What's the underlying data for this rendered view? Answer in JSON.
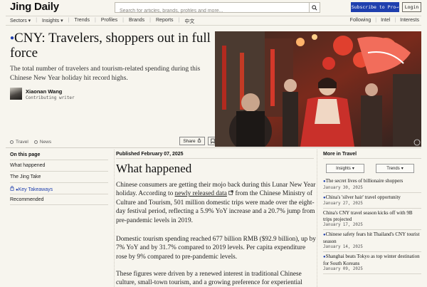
{
  "brand": {
    "logo": "Jing Daily",
    "accent": "#1f3fae"
  },
  "header": {
    "search_placeholder": "Search for articles, brands, profiles and more...",
    "subscribe_label": "Subscribe to Pro",
    "login_label": "Login"
  },
  "nav": {
    "left": [
      "Sectors",
      "Insights",
      "Trends",
      "Profiles",
      "Brands",
      "Reports",
      "中文"
    ],
    "right": [
      "Following",
      "Intel",
      "Interests"
    ]
  },
  "article": {
    "headline": "CNY: Travelers, shoppers out in full force",
    "dek": "The total number of travelers and tourism-related spending during this Chinese New Year holiday hit record highs.",
    "author_name": "Xiaonan Wang",
    "author_role": "Contributing writer",
    "tags": [
      "Travel",
      "News"
    ],
    "share_label": "Share",
    "published": "Published February 07, 2025",
    "section_heading": "What happened",
    "p1_a": "Chinese consumers are getting their mojo back during this Lunar New Year holiday. According to ",
    "p1_link": "newly released data",
    "p1_b": " from the Chinese Ministry of Culture and Tourism, 501 million domestic trips were made over the eight-day festival period, reflecting a 5.9% YoY increase and a 20.7% jump from pre-pandemic levels in 2019.",
    "p2": "Domestic tourism spending reached 677 billion RMB ($92.9 billion), up by 7% YoY and by 31.7% compared to 2019 levels. Per capita expenditure rose by 9% compared to pre-pandemic levels.",
    "p3": "These figures were driven by a renewed interest in traditional Chinese culture, small-town tourism, and a growing preference for experiential"
  },
  "toc": {
    "title": "On this page",
    "items": [
      {
        "label": "What happened"
      },
      {
        "label": "The Jing Take"
      },
      {
        "label": "Key Takeaways"
      },
      {
        "label": "Recommended"
      }
    ]
  },
  "rail": {
    "title": "More in Travel",
    "filters": [
      "Insights",
      "Trends"
    ],
    "items": [
      {
        "title": "The secret lives of billionaire shoppers",
        "date": "January 30, 2025"
      },
      {
        "title": "China's 'silver hair' travel opportunity",
        "date": "January 27, 2025"
      },
      {
        "title": "China's CNY travel season kicks off with 9B trips projected",
        "date": "January 17, 2025"
      },
      {
        "title": "Chinese safety fears hit Thailand's CNY tourist season",
        "date": "January 14, 2025"
      },
      {
        "title": "Shanghai beats Tokyo as top winter destination for South Koreans",
        "date": "January 09, 2025"
      }
    ]
  }
}
